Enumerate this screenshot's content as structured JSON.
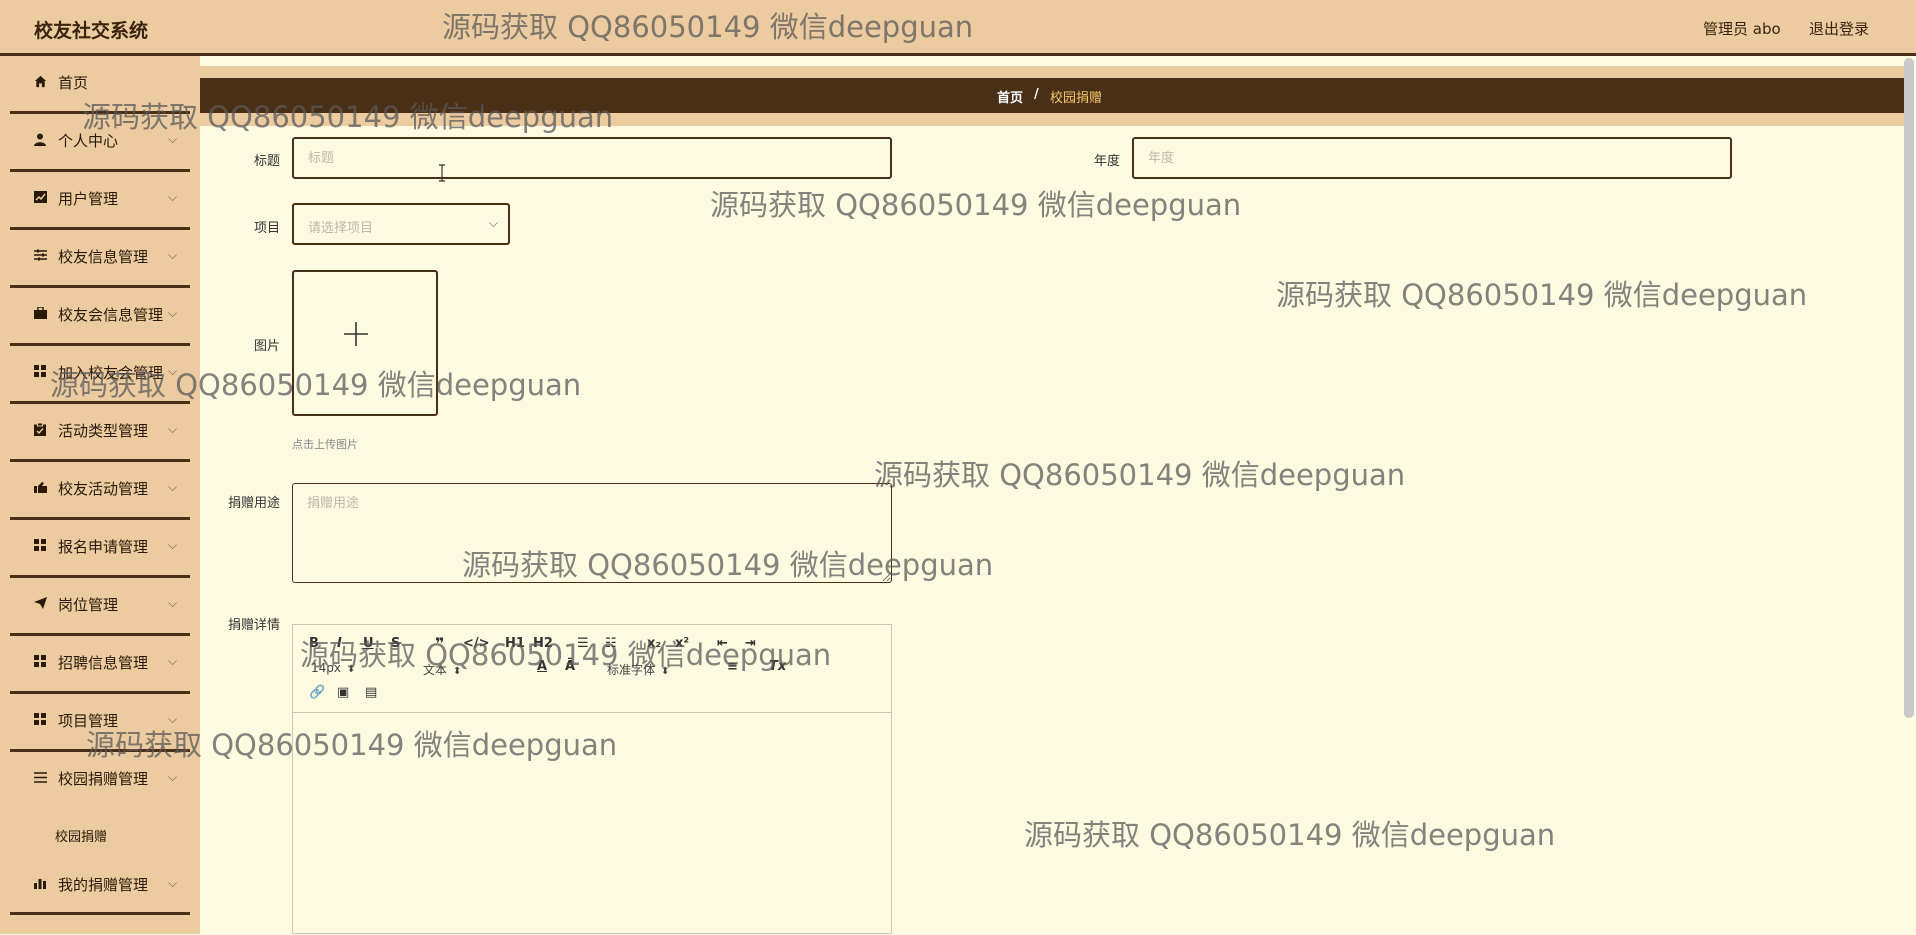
{
  "app": {
    "title": "校友社交系统"
  },
  "header": {
    "admin": "管理员 abo",
    "logout": "退出登录"
  },
  "sidebar": {
    "items": [
      {
        "label": "首页",
        "icon": "home-icon",
        "chevron": false
      },
      {
        "label": "个人中心",
        "icon": "user-icon",
        "chevron": true
      },
      {
        "label": "用户管理",
        "icon": "chart-icon",
        "chevron": true
      },
      {
        "label": "校友信息管理",
        "icon": "sliders-icon",
        "chevron": true
      },
      {
        "label": "校友会信息管理",
        "icon": "briefcase-icon",
        "chevron": true
      },
      {
        "label": "加入校友会管理",
        "icon": "grid-icon",
        "chevron": true
      },
      {
        "label": "活动类型管理",
        "icon": "clipboard-icon",
        "chevron": true
      },
      {
        "label": "校友活动管理",
        "icon": "hand-icon",
        "chevron": true
      },
      {
        "label": "报名申请管理",
        "icon": "grid-icon",
        "chevron": true
      },
      {
        "label": "岗位管理",
        "icon": "send-icon",
        "chevron": true
      },
      {
        "label": "招聘信息管理",
        "icon": "grid-icon",
        "chevron": true
      },
      {
        "label": "项目管理",
        "icon": "grid-icon",
        "chevron": true
      },
      {
        "label": "校园捐赠管理",
        "icon": "list-icon",
        "chevron": true
      },
      {
        "label": "校园捐赠",
        "icon": "",
        "chevron": false,
        "sub": true
      },
      {
        "label": "我的捐赠管理",
        "icon": "bar-chart-icon",
        "chevron": true
      }
    ]
  },
  "breadcrumb": {
    "home": "首页",
    "separator": "/",
    "current": "校园捐赠"
  },
  "form": {
    "title_label": "标题",
    "title_placeholder": "标题",
    "year_label": "年度",
    "year_placeholder": "年度",
    "project_label": "项目",
    "project_placeholder": "请选择项目",
    "image_label": "图片",
    "image_hint": "点击上传图片",
    "purpose_label": "捐赠用途",
    "purpose_placeholder": "捐赠用途",
    "detail_label": "捐赠详情"
  },
  "editor": {
    "font_size": "14px",
    "paragraph": "文本",
    "font_family": "标准字体"
  },
  "watermark": "源码获取 QQ86050149 微信deepguan"
}
